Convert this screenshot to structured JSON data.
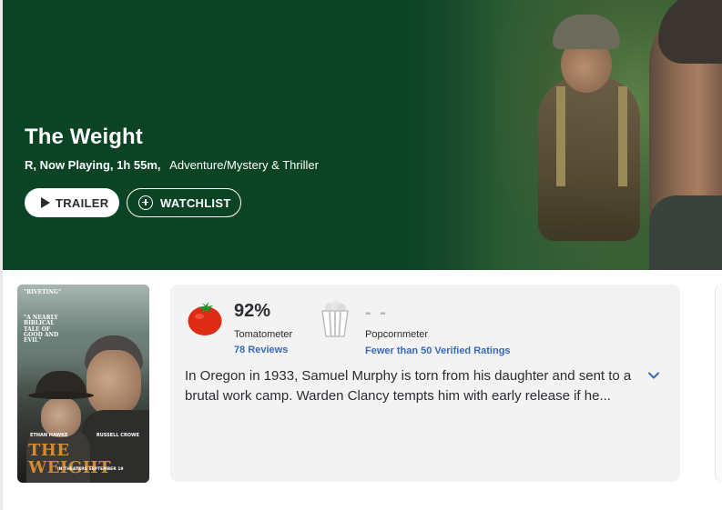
{
  "hero": {
    "title": "The Weight",
    "meta_details": "R, Now Playing, 1h 55m,",
    "meta_genre": "Adventure/Mystery & Thriller",
    "trailer_label": "TRAILER",
    "watchlist_label": "WATCHLIST",
    "background_color": "#0b4425"
  },
  "poster": {
    "quote1": "\"RIVETING\"",
    "quote2": "\"A NEARLY BIBLICAL TALE OF GOOD AND EVIL\"",
    "actor1": "ETHAN HAWKE",
    "actor2": "RUSSELL CROWE",
    "title": "THE WEIGHT",
    "release": "IN THEATERS SEPTEMBER 19"
  },
  "scores": {
    "tomatometer": {
      "value": "92%",
      "label": "Tomatometer",
      "reviews": "78 Reviews",
      "icon": "tomato-icon"
    },
    "popcornmeter": {
      "value": "- -",
      "label": "Popcornmeter",
      "ratings": "Fewer than 50 Verified Ratings",
      "icon": "popcorn-icon"
    }
  },
  "synopsis": "In Oregon in 1933, Samuel Murphy is torn from his daughter and sent to a brutal work camp. Warden Clancy tempts him with early release if he...",
  "colors": {
    "link": "#3a6ab7",
    "tomato": "#e02b14"
  }
}
